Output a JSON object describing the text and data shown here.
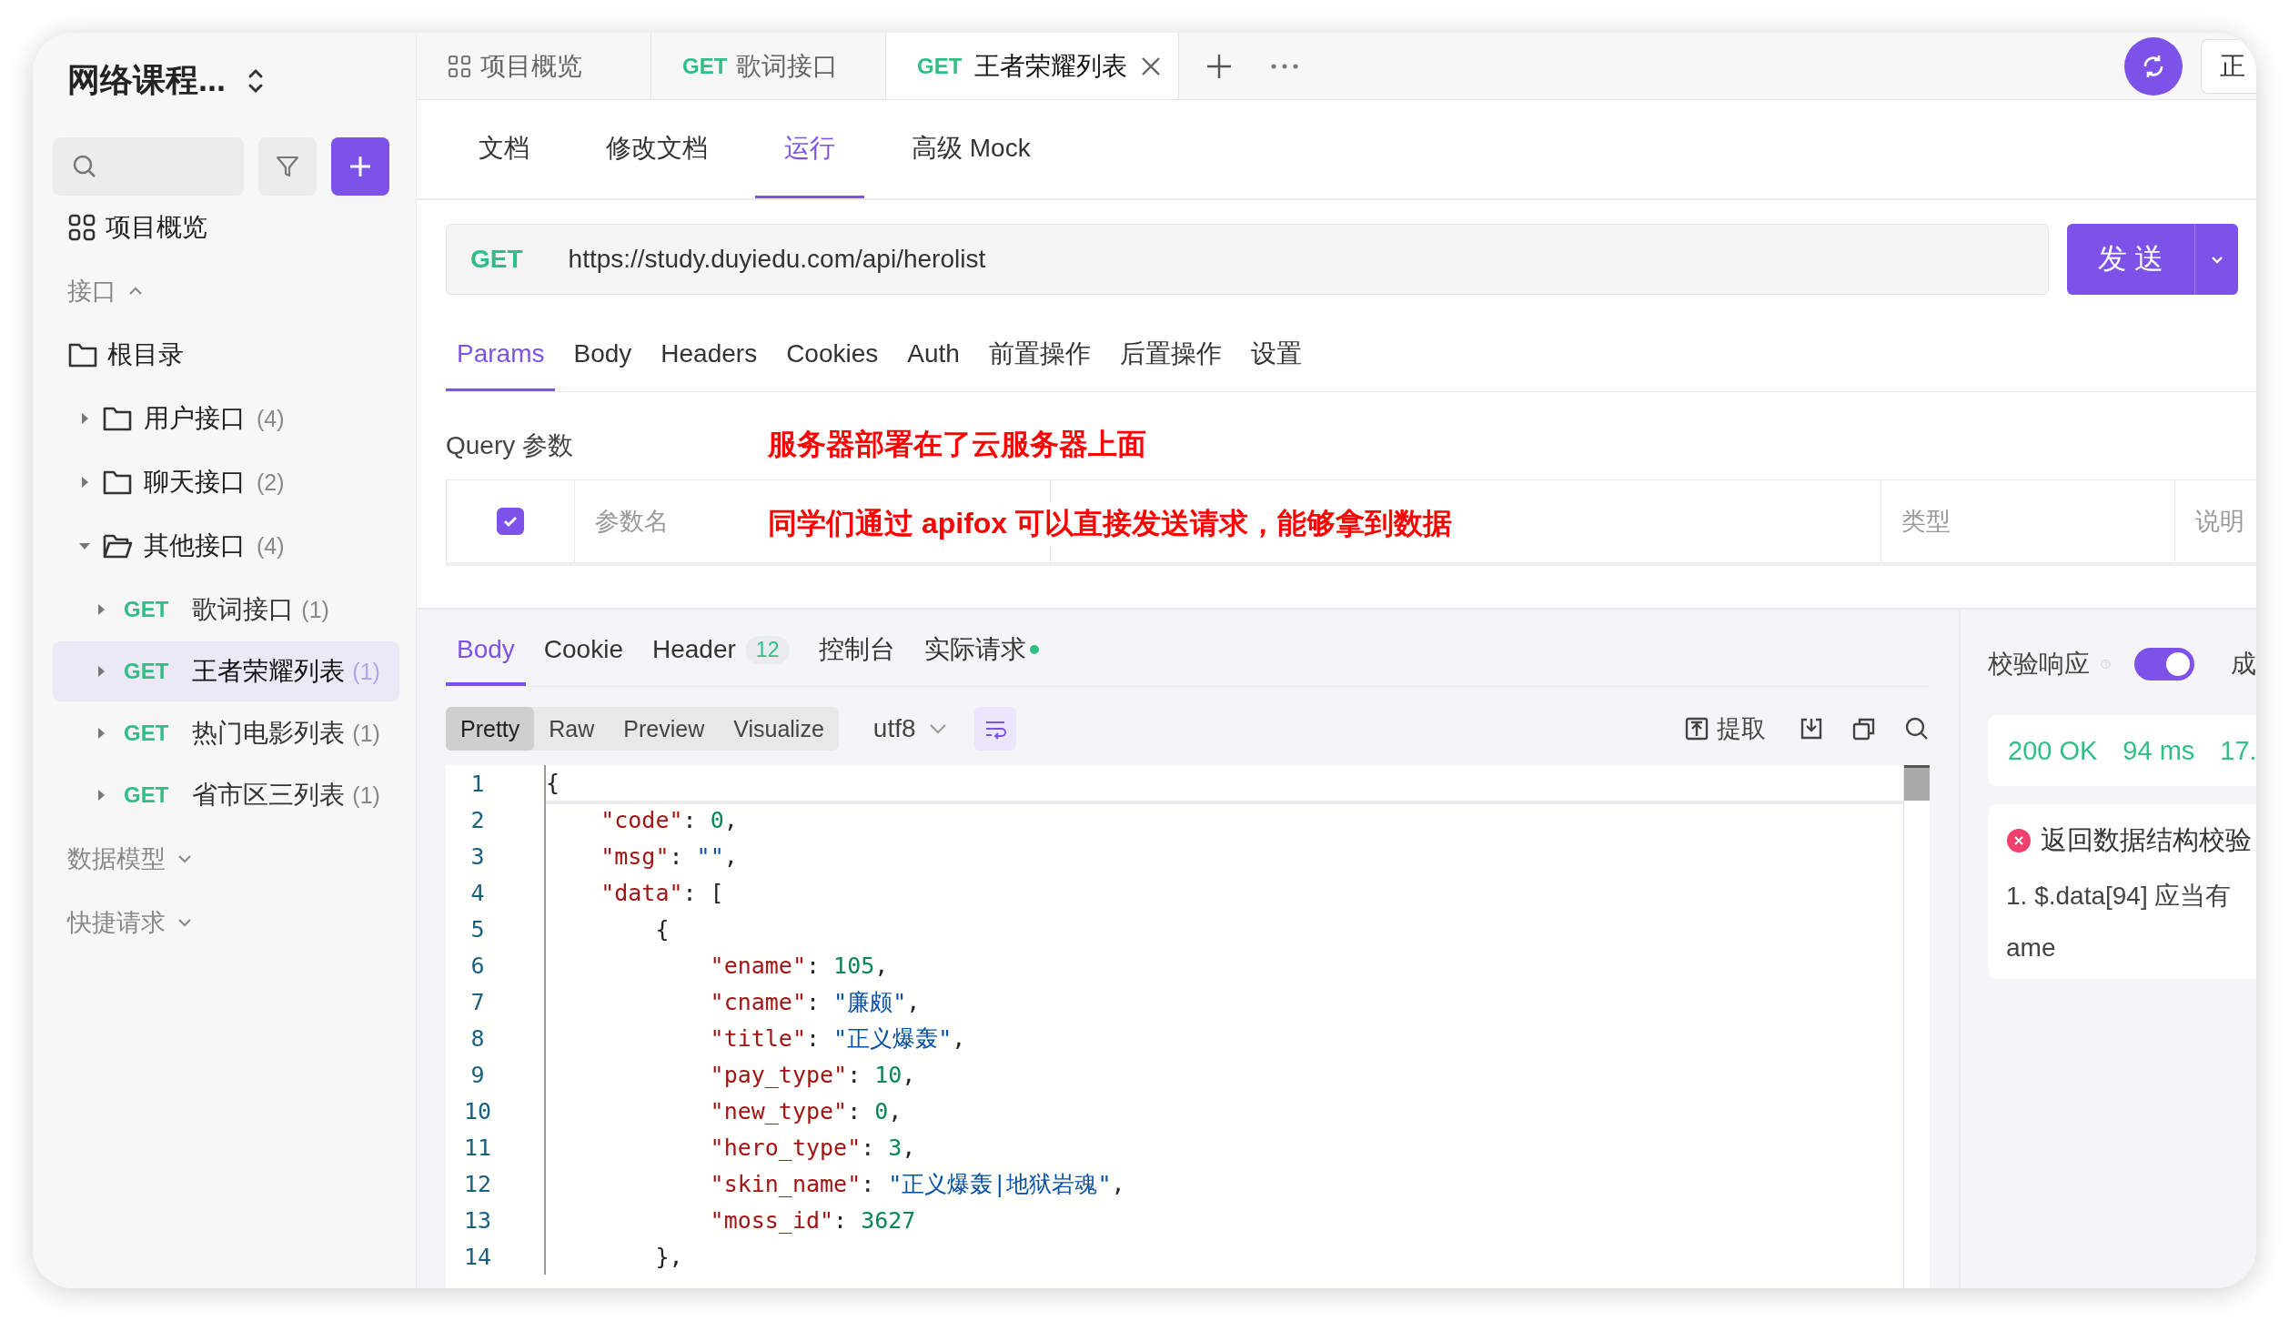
{
  "sidebar": {
    "project": "网络课程...",
    "overview": "项目概览",
    "sections": [
      {
        "label": "接口",
        "expanded": true
      },
      {
        "label": "数据模型",
        "expanded": false
      },
      {
        "label": "快捷请求",
        "expanded": false
      }
    ],
    "root": "根目录",
    "tree": [
      {
        "label": "用户接口",
        "count": "(4)",
        "expanded": false
      },
      {
        "label": "聊天接口",
        "count": "(2)",
        "expanded": false
      },
      {
        "label": "其他接口",
        "count": "(4)",
        "expanded": true,
        "children": [
          {
            "method": "GET",
            "label": "歌词接口",
            "count": "(1)",
            "selected": false
          },
          {
            "method": "GET",
            "label": "王者荣耀列表",
            "count": "(1)",
            "selected": true
          },
          {
            "method": "GET",
            "label": "热门电影列表",
            "count": "(1)",
            "selected": false
          },
          {
            "method": "GET",
            "label": "省市区三列表",
            "count": "(1)",
            "selected": false
          }
        ]
      }
    ]
  },
  "tabs": [
    {
      "kind": "overview",
      "label": "项目概览",
      "selected": false
    },
    {
      "kind": "api",
      "method": "GET",
      "label": "歌词接口",
      "selected": false
    },
    {
      "kind": "api",
      "method": "GET",
      "label": "王者荣耀列表",
      "selected": true
    }
  ],
  "environment": "正",
  "sub_tabs": [
    {
      "label": "文档",
      "selected": false
    },
    {
      "label": "修改文档",
      "selected": false
    },
    {
      "label": "运行",
      "selected": true
    },
    {
      "label": "高级 Mock",
      "selected": false
    }
  ],
  "request": {
    "method": "GET",
    "url": "https://study.duyiedu.com/api/herolist",
    "send": "发 送"
  },
  "param_tabs": [
    {
      "label": "Params",
      "selected": true
    },
    {
      "label": "Body",
      "selected": false
    },
    {
      "label": "Headers",
      "selected": false
    },
    {
      "label": "Cookies",
      "selected": false
    },
    {
      "label": "Auth",
      "selected": false
    },
    {
      "label": "前置操作",
      "selected": false
    },
    {
      "label": "后置操作",
      "selected": false
    },
    {
      "label": "设置",
      "selected": false
    }
  ],
  "query": {
    "label": "Query 参数",
    "checked": true,
    "columns": [
      "参数名",
      "类型",
      "说明"
    ]
  },
  "annotations": [
    "服务器部署在了云服务器上面",
    "同学们通过 apifox 可以直接发送请求，能够拿到数据"
  ],
  "response_tabs": [
    {
      "label": "Body",
      "selected": true
    },
    {
      "label": "Cookie",
      "selected": false
    },
    {
      "label": "Header",
      "badge": "12",
      "selected": false
    },
    {
      "label": "控制台",
      "selected": false
    },
    {
      "label": "实际请求",
      "dot": true,
      "selected": false
    }
  ],
  "view_modes": [
    {
      "label": "Pretty",
      "selected": true
    },
    {
      "label": "Raw",
      "selected": false
    },
    {
      "label": "Preview",
      "selected": false
    },
    {
      "label": "Visualize",
      "selected": false
    }
  ],
  "encoding": "utf8",
  "wrap": true,
  "extract": "提取",
  "code": [
    {
      "num": "1",
      "tokens": [
        {
          "kind": "punct",
          "text": "{"
        }
      ]
    },
    {
      "num": "2",
      "tokens": [
        {
          "kind": "key",
          "text": "    \"code\""
        },
        {
          "kind": "punct",
          "text": ": "
        },
        {
          "kind": "num",
          "text": "0"
        },
        {
          "kind": "punct",
          "text": ","
        }
      ]
    },
    {
      "num": "3",
      "tokens": [
        {
          "kind": "key",
          "text": "    \"msg\""
        },
        {
          "kind": "punct",
          "text": ": "
        },
        {
          "kind": "str",
          "text": "\"\""
        },
        {
          "kind": "punct",
          "text": ","
        }
      ]
    },
    {
      "num": "4",
      "tokens": [
        {
          "kind": "key",
          "text": "    \"data\""
        },
        {
          "kind": "punct",
          "text": ": ["
        }
      ]
    },
    {
      "num": "5",
      "tokens": [
        {
          "kind": "punct",
          "text": "        {"
        }
      ]
    },
    {
      "num": "6",
      "tokens": [
        {
          "kind": "key",
          "text": "            \"ename\""
        },
        {
          "kind": "punct",
          "text": ": "
        },
        {
          "kind": "num",
          "text": "105"
        },
        {
          "kind": "punct",
          "text": ","
        }
      ]
    },
    {
      "num": "7",
      "tokens": [
        {
          "kind": "key",
          "text": "            \"cname\""
        },
        {
          "kind": "punct",
          "text": ": "
        },
        {
          "kind": "str",
          "text": "\"廉颇\""
        },
        {
          "kind": "punct",
          "text": ","
        }
      ]
    },
    {
      "num": "8",
      "tokens": [
        {
          "kind": "key",
          "text": "            \"title\""
        },
        {
          "kind": "punct",
          "text": ": "
        },
        {
          "kind": "str",
          "text": "\"正义爆轰\""
        },
        {
          "kind": "punct",
          "text": ","
        }
      ]
    },
    {
      "num": "9",
      "tokens": [
        {
          "kind": "key",
          "text": "            \"pay_type\""
        },
        {
          "kind": "punct",
          "text": ": "
        },
        {
          "kind": "num",
          "text": "10"
        },
        {
          "kind": "punct",
          "text": ","
        }
      ]
    },
    {
      "num": "10",
      "tokens": [
        {
          "kind": "key",
          "text": "            \"new_type\""
        },
        {
          "kind": "punct",
          "text": ": "
        },
        {
          "kind": "num",
          "text": "0"
        },
        {
          "kind": "punct",
          "text": ","
        }
      ]
    },
    {
      "num": "11",
      "tokens": [
        {
          "kind": "key",
          "text": "            \"hero_type\""
        },
        {
          "kind": "punct",
          "text": ": "
        },
        {
          "kind": "num",
          "text": "3"
        },
        {
          "kind": "punct",
          "text": ","
        }
      ]
    },
    {
      "num": "12",
      "tokens": [
        {
          "kind": "key",
          "text": "            \"skin_name\""
        },
        {
          "kind": "punct",
          "text": ": "
        },
        {
          "kind": "str",
          "text": "\"正义爆轰|地狱岩魂\""
        },
        {
          "kind": "punct",
          "text": ","
        }
      ]
    },
    {
      "num": "13",
      "tokens": [
        {
          "kind": "key",
          "text": "            \"moss_id\""
        },
        {
          "kind": "punct",
          "text": ": "
        },
        {
          "kind": "num",
          "text": "3627"
        }
      ]
    },
    {
      "num": "14",
      "tokens": [
        {
          "kind": "punct",
          "text": "        },"
        }
      ]
    }
  ],
  "validation": {
    "label": "校验响应",
    "on": true,
    "next": "成",
    "status": [
      "200 OK",
      "94 ms",
      "17."
    ],
    "error_title": "返回数据结构校验",
    "error_lines": [
      "1. $.data[94] 应当有",
      "ame"
    ]
  }
}
